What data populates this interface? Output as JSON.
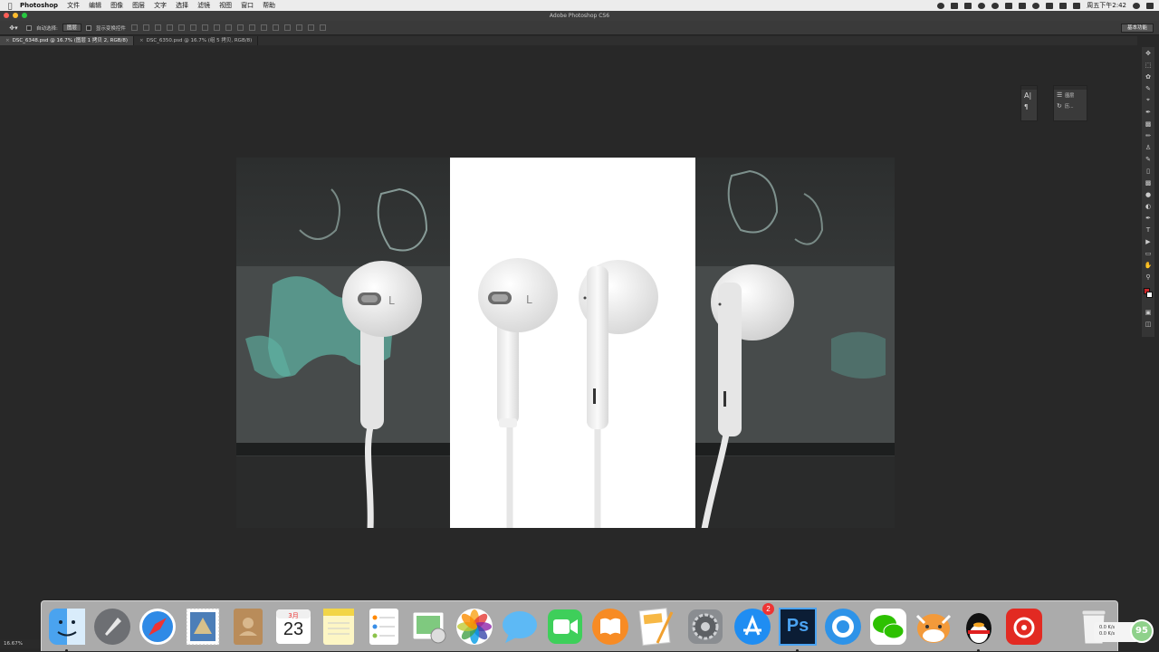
{
  "menubar": {
    "app_name": "Photoshop",
    "items": [
      "文件",
      "编辑",
      "图像",
      "图层",
      "文字",
      "选择",
      "滤镜",
      "视图",
      "窗口",
      "帮助"
    ],
    "clock": "周五下午2:42"
  },
  "window": {
    "title": "Adobe Photoshop CS6"
  },
  "options": {
    "auto_select_label": "自动选择:",
    "auto_select_value": "图层",
    "show_transform_label": "显示变换控件",
    "workspace": "基本功能"
  },
  "tabs": [
    {
      "label": "DSC_6348.psd @ 16.7% (图层 1 拷贝 2, RGB/8)",
      "active": true
    },
    {
      "label": "DSC_6350.psd @ 16.7% (组 5 拷贝, RGB/8)",
      "active": false
    }
  ],
  "panels": {
    "layers_label": "图层",
    "history_label": "历..."
  },
  "status": {
    "zoom": "16.67%"
  },
  "colors": {
    "foreground": "#c8262a",
    "background": "#ffffff"
  },
  "dock": {
    "calendar_month": "3月",
    "calendar_day": "23",
    "appstore_badge": "2",
    "photoshop_label": "Ps"
  },
  "netmon": {
    "up": "0.0 K/s",
    "down": "0.0 K/s",
    "score": "95"
  }
}
